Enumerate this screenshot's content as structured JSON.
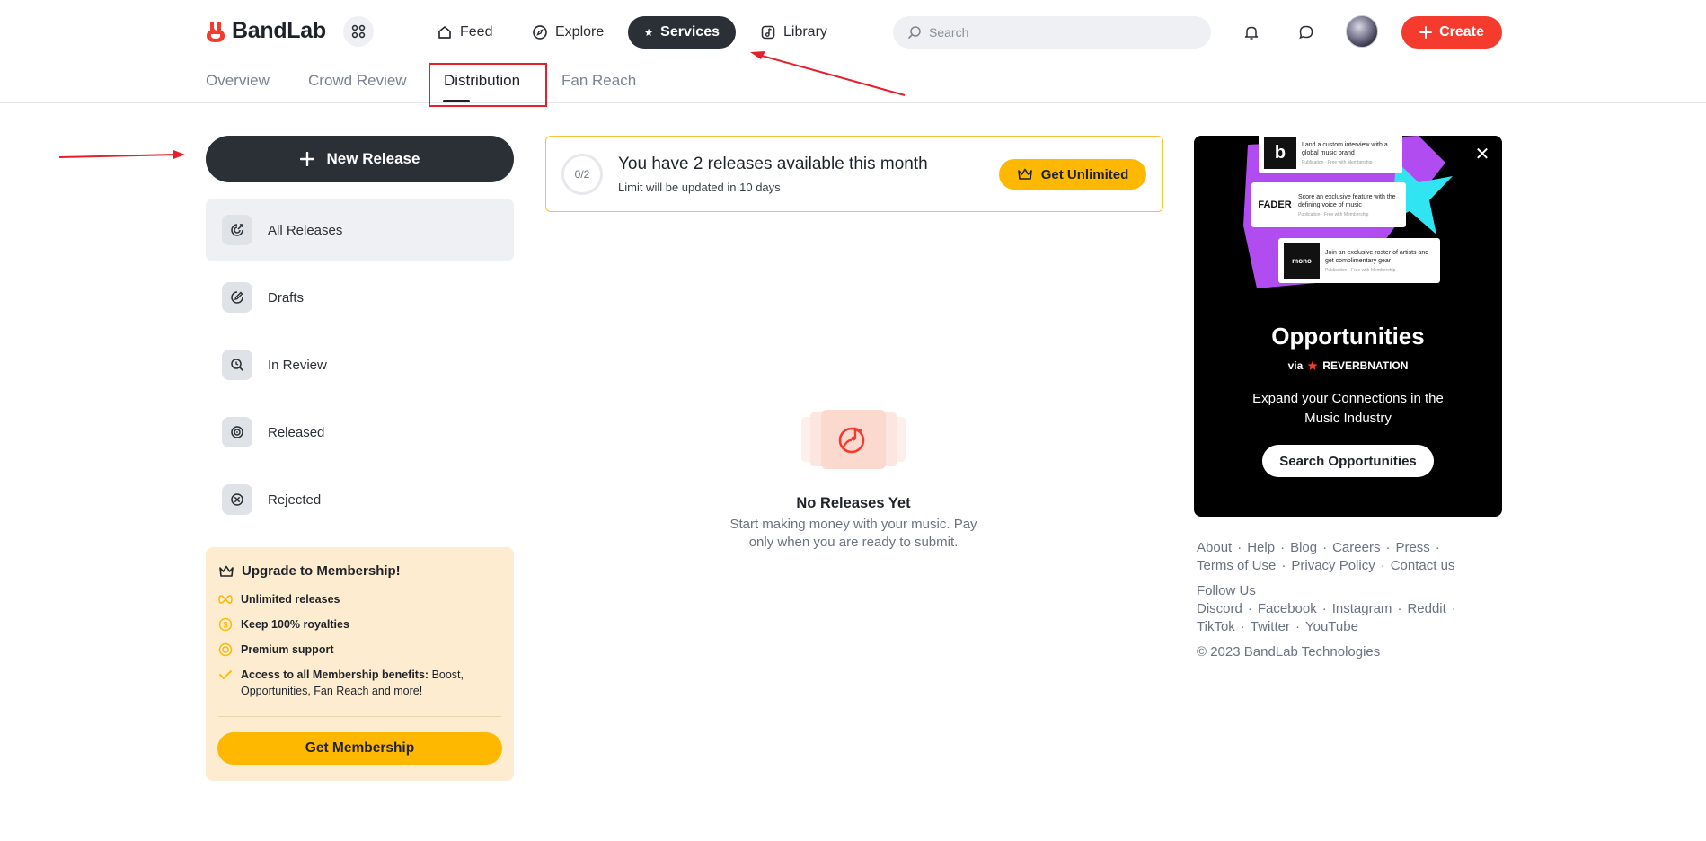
{
  "brand": {
    "name": "BandLab",
    "accent": "#f43b2e"
  },
  "nav": {
    "items": [
      {
        "label": "Feed",
        "icon": "home-icon"
      },
      {
        "label": "Explore",
        "icon": "compass-icon"
      },
      {
        "label": "Services",
        "icon": "star-icon",
        "active": true
      },
      {
        "label": "Library",
        "icon": "music-note-icon"
      }
    ],
    "search_placeholder": "Search",
    "create_label": "Create"
  },
  "subtabs": [
    "Overview",
    "Crowd Review",
    "Distribution",
    "Fan Reach"
  ],
  "active_subtab": "Distribution",
  "sidebar": {
    "new_release_label": "New Release",
    "items": [
      {
        "label": "All Releases",
        "icon": "all-releases-icon",
        "active": true
      },
      {
        "label": "Drafts",
        "icon": "edit-icon"
      },
      {
        "label": "In Review",
        "icon": "review-icon"
      },
      {
        "label": "Released",
        "icon": "released-icon"
      },
      {
        "label": "Rejected",
        "icon": "rejected-icon"
      }
    ]
  },
  "upgrade": {
    "title": "Upgrade to Membership!",
    "benefits": [
      {
        "bold": "Unlimited releases",
        "rest": ""
      },
      {
        "bold": "Keep 100% royalties",
        "rest": ""
      },
      {
        "bold": "Premium support",
        "rest": ""
      },
      {
        "bold": "Access to all Membership benefits:",
        "rest": " Boost, Opportunities, Fan Reach and more!"
      }
    ],
    "button_label": "Get Membership"
  },
  "limit": {
    "counter": "0/2",
    "title": "You have 2 releases available this month",
    "subtitle": "Limit will be updated in 10 days",
    "button_label": "Get Unlimited"
  },
  "empty_state": {
    "title": "No Releases Yet",
    "subtitle": "Start making money with your music. Pay only when you are ready to submit."
  },
  "promo": {
    "cards": [
      {
        "logo": "b",
        "text": "Land a custom interview with a global music brand",
        "meta": "Publication · Free with Membership"
      },
      {
        "logo": "FADER",
        "text": "Score an exclusive feature with the defining voice of music",
        "meta": "Publication · Free with Membership"
      },
      {
        "logo": "mono",
        "text": "Join an exclusive roster of artists and get complimentary gear",
        "meta": "Publication · Free with Membership"
      }
    ],
    "title": "Opportunities",
    "via": "via",
    "partner": "REVERBNATION",
    "description": "Expand your Connections in the Music Industry",
    "button_label": "Search Opportunities"
  },
  "footer": {
    "links_row1": [
      "About",
      "Help",
      "Blog",
      "Careers",
      "Press"
    ],
    "links_row2": [
      "Terms of Use",
      "Privacy Policy",
      "Contact us"
    ],
    "follow_label": "Follow Us",
    "social_row1": [
      "Discord",
      "Facebook",
      "Instagram",
      "Reddit"
    ],
    "social_row2": [
      "TikTok",
      "Twitter",
      "YouTube"
    ],
    "copyright": "© 2023 BandLab Technologies"
  }
}
